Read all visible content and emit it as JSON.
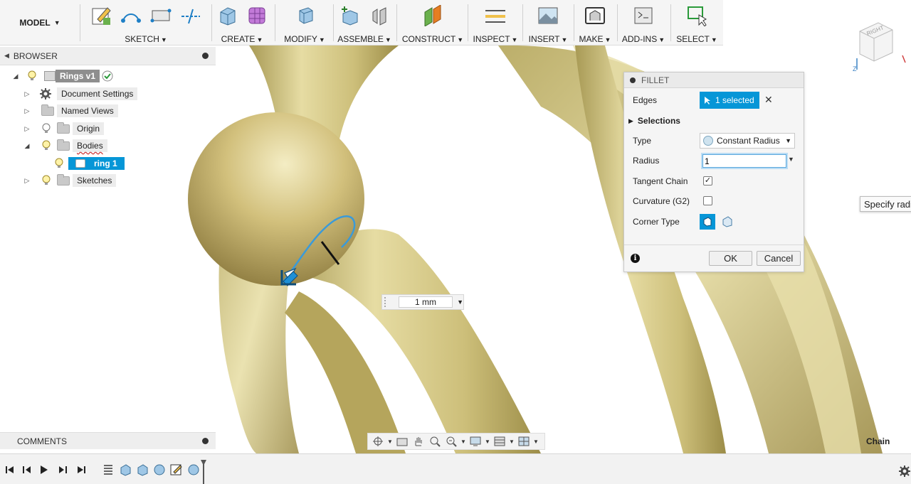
{
  "toolbar": {
    "model": "MODEL",
    "groups": [
      {
        "label": "SKETCH",
        "icons": [
          "create-sketch-icon",
          "arc-icon",
          "rectangle-icon",
          "trim-icon"
        ]
      },
      {
        "label": "CREATE",
        "icons": [
          "extrude-icon",
          "form-icon"
        ]
      },
      {
        "label": "MODIFY",
        "icons": [
          "press-pull-icon"
        ]
      },
      {
        "label": "ASSEMBLE",
        "icons": [
          "new-component-icon",
          "joint-icon"
        ]
      },
      {
        "label": "CONSTRUCT",
        "icons": [
          "offset-plane-icon"
        ]
      },
      {
        "label": "INSPECT",
        "icons": [
          "measure-icon"
        ]
      },
      {
        "label": "INSERT",
        "icons": [
          "insert-image-icon"
        ]
      },
      {
        "label": "MAKE",
        "icons": [
          "3d-print-icon"
        ]
      },
      {
        "label": "ADD-INS",
        "icons": [
          "scripts-icon"
        ]
      },
      {
        "label": "SELECT",
        "icons": [
          "select-icon"
        ]
      }
    ]
  },
  "browser": {
    "title": "BROWSER",
    "items": [
      {
        "label": "Rings v1"
      },
      {
        "label": "Document Settings"
      },
      {
        "label": "Named Views"
      },
      {
        "label": "Origin"
      },
      {
        "label": "Bodies"
      },
      {
        "label": "ring 1"
      },
      {
        "label": "Sketches"
      }
    ]
  },
  "fillet": {
    "title": "FILLET",
    "edges_label": "Edges",
    "edges_value": "1 selected",
    "selections_label": "Selections",
    "type_label": "Type",
    "type_value": "Constant Radius",
    "radius_label": "Radius",
    "radius_value": "1",
    "tangent_label": "Tangent Chain",
    "tangent_checked": true,
    "curvature_label": "Curvature (G2)",
    "curvature_checked": false,
    "corner_label": "Corner Type",
    "ok": "OK",
    "cancel": "Cancel"
  },
  "viewport": {
    "measure_value": "1 mm",
    "tooltip": "Specify radius",
    "chain_label": "Chain",
    "viewcube_face": "RIGHT",
    "ring_color": "#d4c98a"
  },
  "comments": {
    "title": "COMMENTS"
  },
  "colors": {
    "accent": "#0696d7",
    "gold": "#c8b870"
  }
}
